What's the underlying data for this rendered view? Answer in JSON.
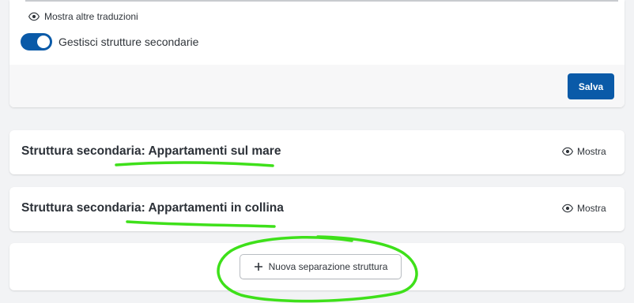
{
  "form": {
    "show_translations_label": "Mostra altre traduzioni",
    "manage_secondary_label": "Gestisci strutture secondarie",
    "manage_secondary_enabled": true,
    "save_label": "Salva"
  },
  "secondary_structures": [
    {
      "title": "Struttura secondaria: Appartamenti sul mare",
      "show_label": "Mostra"
    },
    {
      "title": "Struttura secondaria: Appartamenti in collina",
      "show_label": "Mostra"
    }
  ],
  "new_separation_label": "Nuova separazione struttura",
  "colors": {
    "primary": "#0a5aa8",
    "annotation": "#3ee01a"
  },
  "icons": [
    "eye-icon",
    "plus-icon"
  ]
}
